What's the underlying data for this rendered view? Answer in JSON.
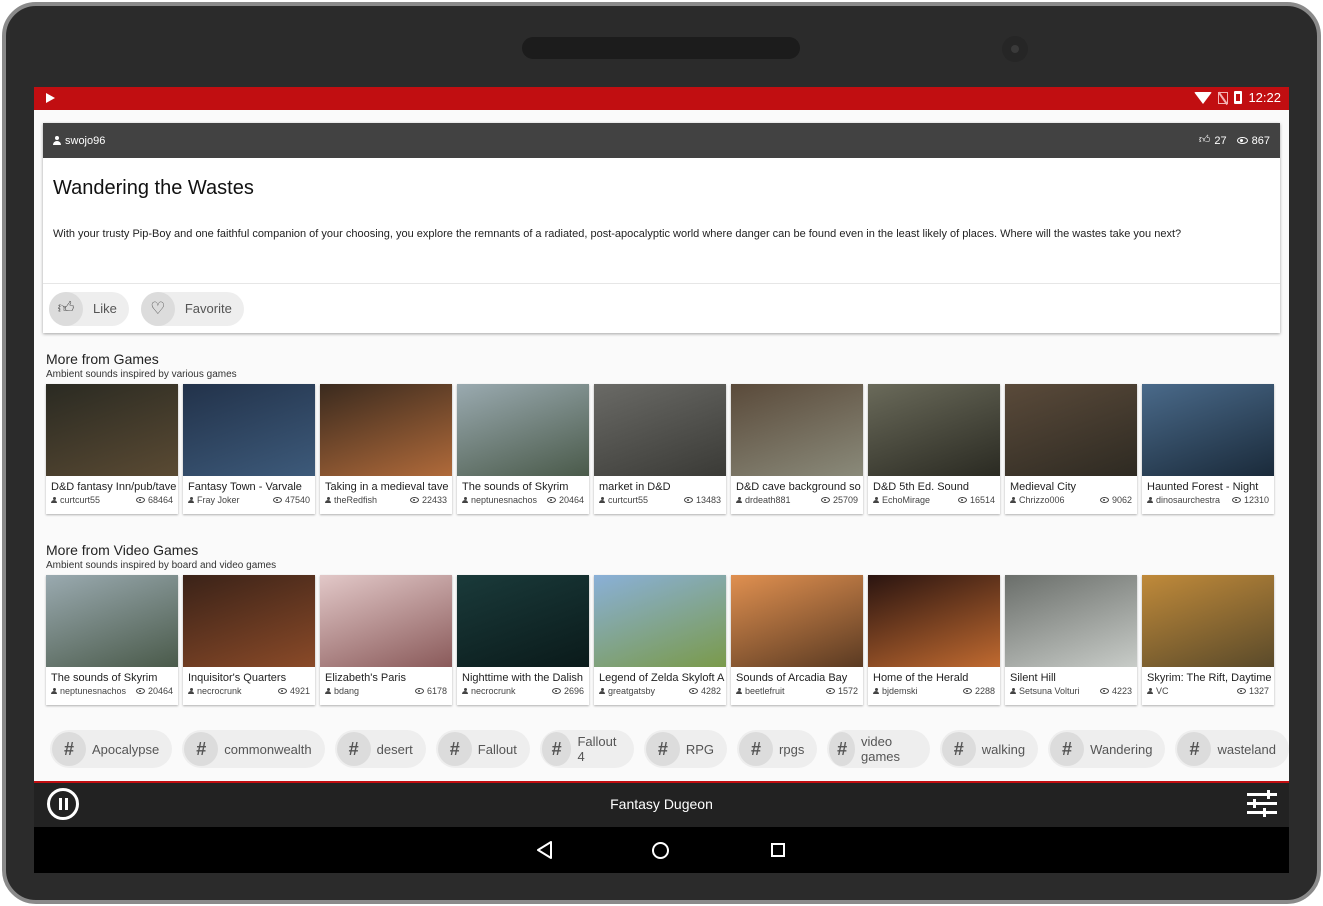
{
  "status_bar": {
    "time": "12:22"
  },
  "detail": {
    "author": "swojo96",
    "likes": "27",
    "views": "867",
    "title": "Wandering the Wastes",
    "description": "With your trusty Pip-Boy and one faithful companion of your choosing, you explore the remnants of a radiated, post-apocalyptic world where danger can be found even in the least likely of places. Where will the wastes take you next?",
    "like_label": "Like",
    "favorite_label": "Favorite"
  },
  "sections": [
    {
      "title": "More from Games",
      "subtitle": "Ambient sounds inspired by various games",
      "items": [
        {
          "title": "D&D fantasy Inn/pub/tave",
          "author": "curtcurt55",
          "views": "68464",
          "colors": [
            "#2a2a22",
            "#5a4a33"
          ]
        },
        {
          "title": "Fantasy Town - Varvale",
          "author": "Fray Joker",
          "views": "47540",
          "colors": [
            "#22324a",
            "#3d5a7a"
          ]
        },
        {
          "title": "Taking in a medieval tave",
          "author": "theRedfish",
          "views": "22433",
          "colors": [
            "#3a2a1e",
            "#b06a3a"
          ]
        },
        {
          "title": "The sounds of Skyrim",
          "author": "neptunesnachos",
          "views": "20464",
          "colors": [
            "#9aaab0",
            "#4a5a4a"
          ]
        },
        {
          "title": "market in D&D",
          "author": "curtcurt55",
          "views": "13483",
          "colors": [
            "#6a6a66",
            "#3a3a36"
          ]
        },
        {
          "title": "D&D cave background so",
          "author": "drdeath881",
          "views": "25709",
          "colors": [
            "#5a4a3a",
            "#8a8a7a"
          ]
        },
        {
          "title": "D&D 5th Ed. Sound",
          "author": "EchoMirage",
          "views": "16514",
          "colors": [
            "#6a6a5a",
            "#2a2a22"
          ]
        },
        {
          "title": "Medieval City",
          "author": "Chrizzo006",
          "views": "9062",
          "colors": [
            "#5a4a3a",
            "#2e2a22"
          ]
        },
        {
          "title": "Haunted Forest - Night",
          "author": "dinosaurchestra",
          "views": "12310",
          "colors": [
            "#4a6a8a",
            "#1a2a3a"
          ]
        }
      ]
    },
    {
      "title": "More from Video Games",
      "subtitle": "Ambient sounds inspired by board and video games",
      "items": [
        {
          "title": "The sounds of Skyrim",
          "author": "neptunesnachos",
          "views": "20464",
          "colors": [
            "#9aaab0",
            "#4a5a4a"
          ]
        },
        {
          "title": "Inquisitor's Quarters",
          "author": "necrocrunk",
          "views": "4921",
          "colors": [
            "#3a2218",
            "#8a4a28"
          ]
        },
        {
          "title": "Elizabeth's Paris",
          "author": "bdang",
          "views": "6178",
          "colors": [
            "#e2c8c8",
            "#8a5a5a"
          ]
        },
        {
          "title": "Nighttime with the Dalish",
          "author": "necrocrunk",
          "views": "2696",
          "colors": [
            "#1a3a3a",
            "#0a1a1a"
          ]
        },
        {
          "title": "Legend of Zelda Skyloft A",
          "author": "greatgatsby",
          "views": "4282",
          "colors": [
            "#8ab0d8",
            "#7a9a4a"
          ]
        },
        {
          "title": "Sounds of Arcadia Bay",
          "author": "beetlefruit",
          "views": "1572",
          "colors": [
            "#e09050",
            "#5a3a22"
          ]
        },
        {
          "title": "Home of the Herald",
          "author": "bjdemski",
          "views": "2288",
          "colors": [
            "#2a1410",
            "#c06a30"
          ]
        },
        {
          "title": "Silent Hill",
          "author": "Setsuna Volturi",
          "views": "4223",
          "colors": [
            "#6a6e6a",
            "#c8ccc8"
          ]
        },
        {
          "title": "Skyrim: The Rift, Daytime",
          "author": "VC",
          "views": "1327",
          "colors": [
            "#c08a3a",
            "#5a4a2a"
          ]
        }
      ]
    }
  ],
  "tags": [
    "Apocalypse",
    "commonwealth",
    "desert",
    "Fallout",
    "Fallout 4",
    "RPG",
    "rpgs",
    "video games",
    "walking",
    "Wandering",
    "wasteland"
  ],
  "tag_symbol": "#",
  "player": {
    "title": "Fantasy Dugeon",
    "state": "playing"
  },
  "colors": {
    "accent": "#c10e11",
    "header": "#424242",
    "player": "#222222"
  },
  "icons": {
    "status": [
      "play-icon",
      "wifi-icon",
      "no-sim-icon",
      "battery-icon"
    ],
    "card": [
      "person-icon",
      "thumb-up-icon",
      "eye-icon",
      "heart-icon"
    ],
    "player": [
      "pause-icon",
      "mixer-icon"
    ],
    "nav": [
      "back-icon",
      "home-icon",
      "recents-icon"
    ]
  }
}
